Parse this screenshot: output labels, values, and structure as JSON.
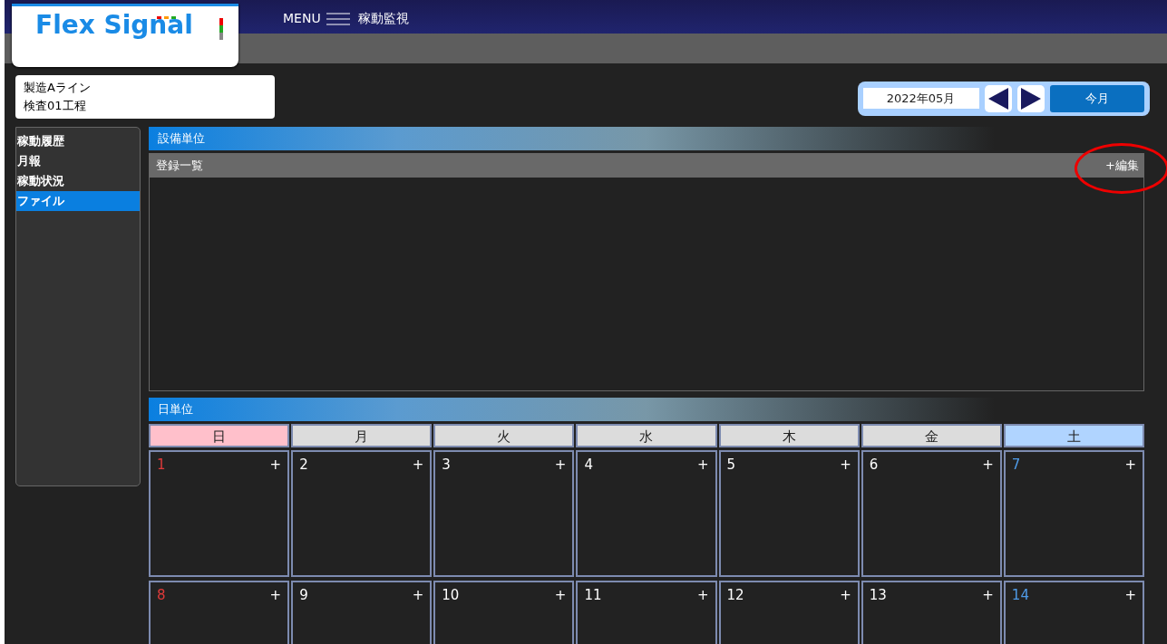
{
  "logo": {
    "text": "Flex Signal"
  },
  "header": {
    "menu_label": "MENU",
    "title": "稼動監視"
  },
  "location": {
    "lines": [
      "製造Aライン",
      "検査01工程"
    ]
  },
  "month_picker": {
    "value": "2022年05月",
    "current_button": "今月"
  },
  "sidebar": {
    "items": [
      {
        "label": "稼動履歴",
        "selected": false
      },
      {
        "label": "月報",
        "selected": false
      },
      {
        "label": "稼動状況",
        "selected": false
      },
      {
        "label": "ファイル",
        "selected": true
      }
    ]
  },
  "equipment_section": {
    "title": "設備単位",
    "list_title": "登録一覧",
    "edit_link": "+編集"
  },
  "daily_section": {
    "title": "日単位",
    "weekdays": [
      {
        "label": "日",
        "kind": "sunday"
      },
      {
        "label": "月",
        "kind": "weekday"
      },
      {
        "label": "火",
        "kind": "weekday"
      },
      {
        "label": "水",
        "kind": "weekday"
      },
      {
        "label": "木",
        "kind": "weekday"
      },
      {
        "label": "金",
        "kind": "weekday"
      },
      {
        "label": "土",
        "kind": "saturday"
      }
    ],
    "weeks": [
      [
        {
          "day": "1",
          "kind": "sunday",
          "add": "+"
        },
        {
          "day": "2",
          "kind": "weekday",
          "add": "+"
        },
        {
          "day": "3",
          "kind": "weekday",
          "add": "+"
        },
        {
          "day": "4",
          "kind": "weekday",
          "add": "+"
        },
        {
          "day": "5",
          "kind": "weekday",
          "add": "+"
        },
        {
          "day": "6",
          "kind": "weekday",
          "add": "+"
        },
        {
          "day": "7",
          "kind": "saturday",
          "add": "+"
        }
      ],
      [
        {
          "day": "8",
          "kind": "sunday",
          "add": "+"
        },
        {
          "day": "9",
          "kind": "weekday",
          "add": "+"
        },
        {
          "day": "10",
          "kind": "weekday",
          "add": "+"
        },
        {
          "day": "11",
          "kind": "weekday",
          "add": "+"
        },
        {
          "day": "12",
          "kind": "weekday",
          "add": "+"
        },
        {
          "day": "13",
          "kind": "weekday",
          "add": "+"
        },
        {
          "day": "14",
          "kind": "saturday",
          "add": "+"
        }
      ]
    ]
  }
}
